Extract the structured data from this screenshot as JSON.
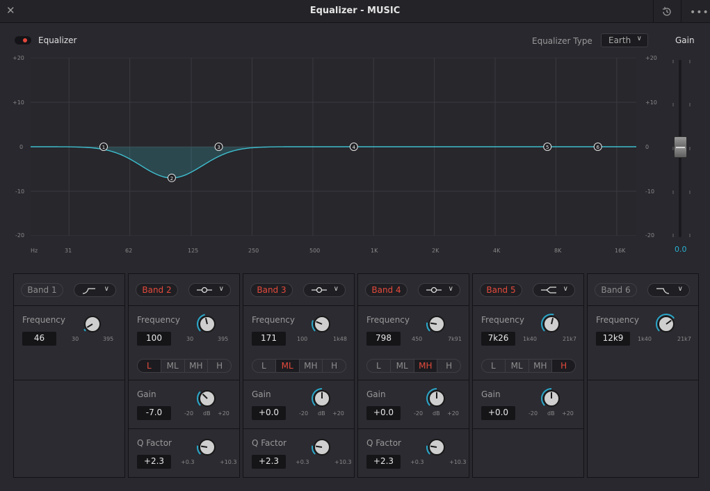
{
  "window": {
    "title": "Equalizer - MUSIC",
    "close_glyph": "✕",
    "more_glyph": "•••"
  },
  "header": {
    "equalizer_label": "Equalizer",
    "equalizer_type_label": "Equalizer Type",
    "equalizer_type_value": "Earth",
    "gain_label": "Gain"
  },
  "graph": {
    "y_ticks_left": [
      "+20",
      "+10",
      "0",
      "-10",
      "-20"
    ],
    "y_ticks_right": [
      "+20",
      "+10",
      "0",
      "-10",
      "-20"
    ],
    "x_ticks": [
      "Hz",
      "31",
      "62",
      "125",
      "250",
      "500",
      "1K",
      "2K",
      "4K",
      "8K",
      "16K"
    ],
    "curve_color": "#3fbfcf",
    "nodes": [
      {
        "label": "1",
        "freq": 46,
        "gain": 0.0
      },
      {
        "label": "2",
        "freq": 100,
        "gain": -7.0
      },
      {
        "label": "3",
        "freq": 171,
        "gain": 0.0
      },
      {
        "label": "4",
        "freq": 798,
        "gain": 0.0
      },
      {
        "label": "5",
        "freq": 7260,
        "gain": 0.0
      },
      {
        "label": "6",
        "freq": 12900,
        "gain": 0.0
      }
    ]
  },
  "gain_value": "0.0",
  "bands": [
    {
      "name": "Band 1",
      "enabled": false,
      "shape": "high-pass",
      "frequency_label": "Frequency",
      "frequency": "46",
      "freq_min": "30",
      "freq_max": "395",
      "freq_knob_fraction": 0.05
    },
    {
      "name": "Band 2",
      "enabled": true,
      "shape": "bell",
      "frequency_label": "Frequency",
      "frequency": "100",
      "freq_min": "30",
      "freq_max": "395",
      "freq_knob_fraction": 0.45,
      "ranges": [
        "L",
        "ML",
        "MH",
        "H"
      ],
      "active_range": "L",
      "gain_label": "Gain",
      "gain": "-7.0",
      "gain_min": "-20",
      "gain_unit": "dB",
      "gain_max": "+20",
      "gain_knob_fraction": 0.33,
      "q_label": "Q Factor",
      "q": "+2.3",
      "q_min": "+0.3",
      "q_max": "+10.3",
      "q_knob_fraction": 0.2
    },
    {
      "name": "Band 3",
      "enabled": true,
      "shape": "bell",
      "frequency_label": "Frequency",
      "frequency": "171",
      "freq_min": "100",
      "freq_max": "1k48",
      "freq_knob_fraction": 0.25,
      "ranges": [
        "L",
        "ML",
        "MH",
        "H"
      ],
      "active_range": "ML",
      "gain_label": "Gain",
      "gain": "+0.0",
      "gain_min": "-20",
      "gain_unit": "dB",
      "gain_max": "+20",
      "gain_knob_fraction": 0.5,
      "q_label": "Q Factor",
      "q": "+2.3",
      "q_min": "+0.3",
      "q_max": "+10.3",
      "q_knob_fraction": 0.2
    },
    {
      "name": "Band 4",
      "enabled": true,
      "shape": "bell",
      "frequency_label": "Frequency",
      "frequency": "798",
      "freq_min": "450",
      "freq_max": "7k91",
      "freq_knob_fraction": 0.2,
      "ranges": [
        "L",
        "ML",
        "MH",
        "H"
      ],
      "active_range": "MH",
      "gain_label": "Gain",
      "gain": "+0.0",
      "gain_min": "-20",
      "gain_unit": "dB",
      "gain_max": "+20",
      "gain_knob_fraction": 0.5,
      "q_label": "Q Factor",
      "q": "+2.3",
      "q_min": "+0.3",
      "q_max": "+10.3",
      "q_knob_fraction": 0.2
    },
    {
      "name": "Band 5",
      "enabled": true,
      "shape": "high-shelf",
      "frequency_label": "Frequency",
      "frequency": "7k26",
      "freq_min": "1k40",
      "freq_max": "21k7",
      "freq_knob_fraction": 0.55,
      "ranges": [
        "L",
        "ML",
        "MH",
        "H"
      ],
      "active_range": "H",
      "gain_label": "Gain",
      "gain": "+0.0",
      "gain_min": "-20",
      "gain_unit": "dB",
      "gain_max": "+20",
      "gain_knob_fraction": 0.5
    },
    {
      "name": "Band 6",
      "enabled": false,
      "shape": "low-pass",
      "frequency_label": "Frequency",
      "frequency": "12k9",
      "freq_min": "1k40",
      "freq_max": "21k7",
      "freq_knob_fraction": 0.7
    }
  ]
}
